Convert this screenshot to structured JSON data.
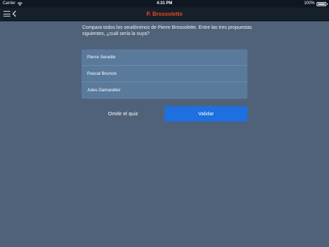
{
  "status_bar": {
    "carrier": "Carrier",
    "time": "4:31 PM",
    "battery": "100%",
    "icons": [
      "wifi-icon",
      "battery-icon"
    ]
  },
  "nav": {
    "title": "P. Brossolette",
    "title_color": "#e8491e",
    "icons": [
      "menu-icon",
      "back-icon"
    ]
  },
  "quiz": {
    "question": "Compara todos los seudónimos de Pierre Brossolette. Entre las tres propuestas siguientes, ¿cuál sería la suya?",
    "options": [
      {
        "label": "Pierre Senette"
      },
      {
        "label": "Pascal Brunois"
      },
      {
        "label": "Jules Damandier"
      }
    ],
    "skip_label": "Omitir el quiz",
    "validate_label": "Validar",
    "accent_color": "#1e6fe0"
  }
}
